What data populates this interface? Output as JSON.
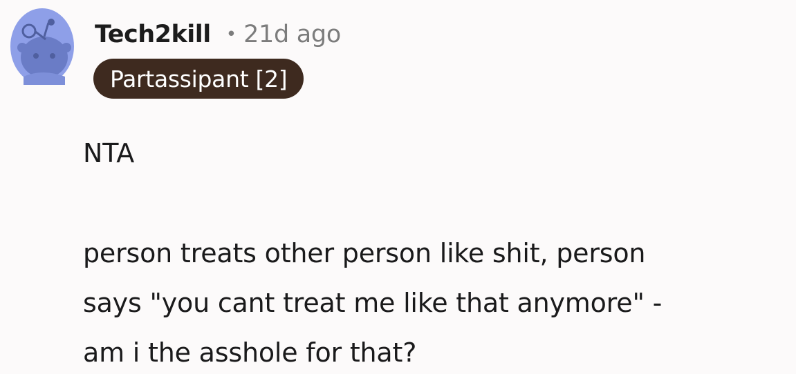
{
  "comment": {
    "author": "Tech2kill",
    "separator": "•",
    "timestamp": "21d ago",
    "flair": "Partassipant [2]",
    "body": {
      "paragraph_1": "NTA",
      "paragraph_2_lines": [
        "person treats other person like shit, person",
        "says \"you cant treat me like that anymore\" -",
        "am i the asshole for that?"
      ]
    },
    "avatar": {
      "icon": "reddit-snoo-default-avatar-icon",
      "bg_color": "#8e9fe8",
      "face_color": "#6071b5"
    }
  }
}
